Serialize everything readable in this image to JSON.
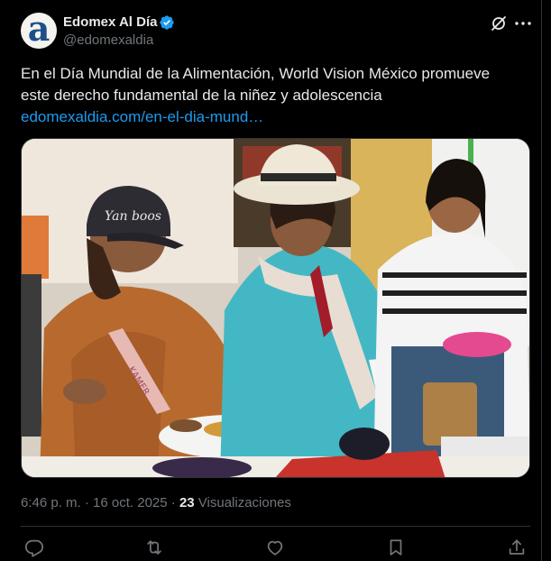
{
  "post": {
    "author": {
      "display_name": "Edomex Al Día",
      "handle": "@edomexaldia",
      "avatar_letter": "a",
      "verified": true
    },
    "text_line1": "En el Día Mundial de la Alimentación, World Vision México promueve",
    "text_line2": "este derecho fundamental de la niñez y adolescencia",
    "link": "edomexaldia.com/en-el-dia-mund…",
    "time": "6:46 p. m. · 16 oct. 2025 · ",
    "views_count": "23",
    "views_label": " Visualizaciones"
  },
  "photo": {
    "cap_text": "Yan boos",
    "sash_text": "KAMER"
  },
  "icons": {
    "verified": "verified-badge-icon",
    "grok": "grok-icon",
    "more": "more-icon",
    "reply": "reply-icon",
    "repost": "repost-icon",
    "like": "like-icon",
    "bookmark": "bookmark-icon",
    "share": "share-icon"
  },
  "colors": {
    "background": "#000000",
    "text": "#e7e9ea",
    "muted": "#71767b",
    "link": "#1d9bf0",
    "border": "#2f3336"
  }
}
